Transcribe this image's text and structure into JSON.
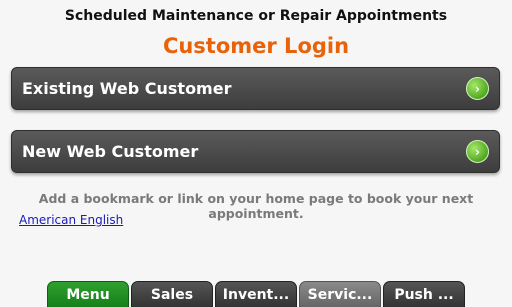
{
  "header": {
    "heading": "Scheduled Maintenance or Repair Appointments",
    "login_title": "Customer Login"
  },
  "buttons": [
    {
      "label": "Existing Web Customer",
      "icon": "chevron-right-icon"
    },
    {
      "label": "New Web Customer",
      "icon": "chevron-right-icon"
    }
  ],
  "icon_glyph": "›",
  "note": "Add a bookmark or link on your home page to book your next appointment.",
  "language_link": "American English",
  "tabs": [
    {
      "label": "Menu",
      "state": "active"
    },
    {
      "label": "Sales",
      "state": "normal"
    },
    {
      "label": "Invent...",
      "state": "normal"
    },
    {
      "label": "Servic...",
      "state": "highlighted"
    },
    {
      "label": "Push ...",
      "state": "normal"
    }
  ],
  "colors": {
    "accent": "#e8620a",
    "active_tab": "#1e8f22",
    "link": "#1a1ab8"
  }
}
